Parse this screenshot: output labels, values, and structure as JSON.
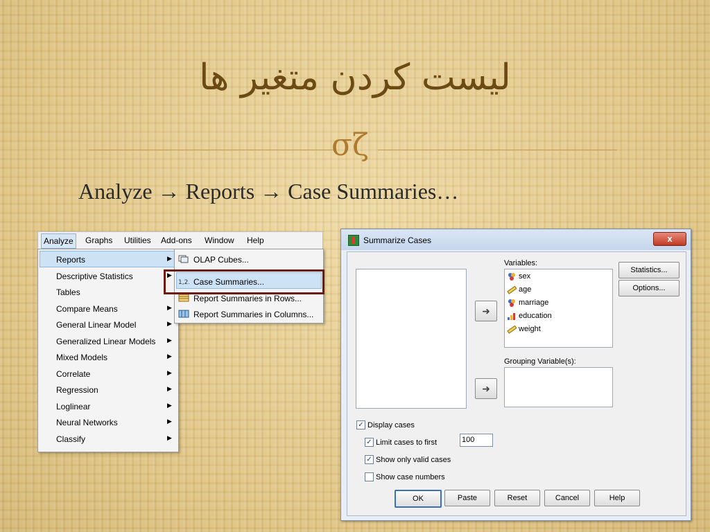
{
  "slide": {
    "title": "لیست کردن متغیر ها",
    "ornament": "σζ",
    "subtitle": "Analyze → Reports → Case Summaries…"
  },
  "menubar": {
    "items": [
      "Analyze",
      "Graphs",
      "Utilities",
      "Add-ons",
      "Window",
      "Help"
    ]
  },
  "analyze_menu": {
    "items": [
      "Reports",
      "Descriptive Statistics",
      "Tables",
      "Compare Means",
      "General Linear Model",
      "Generalized Linear Models",
      "Mixed Models",
      "Correlate",
      "Regression",
      "Loglinear",
      "Neural Networks",
      "Classify"
    ]
  },
  "reports_menu": {
    "items": [
      "OLAP Cubes...",
      "Case Summaries...",
      "Report Summaries in Rows...",
      "Report Summaries in Columns..."
    ]
  },
  "dialog": {
    "title": "Summarize Cases",
    "close_label": "x",
    "variables_label": "Variables:",
    "variables": [
      "sex",
      "age",
      "marriage",
      "education",
      "weight"
    ],
    "grouping_label": "Grouping Variable(s):",
    "statistics_button": "Statistics...",
    "options_button": "Options...",
    "display_cases": "Display cases",
    "limit_cases": "Limit cases to first",
    "limit_value": "100",
    "show_valid": "Show only valid cases",
    "show_numbers": "Show case numbers",
    "buttons": [
      "OK",
      "Paste",
      "Reset",
      "Cancel",
      "Help"
    ]
  }
}
